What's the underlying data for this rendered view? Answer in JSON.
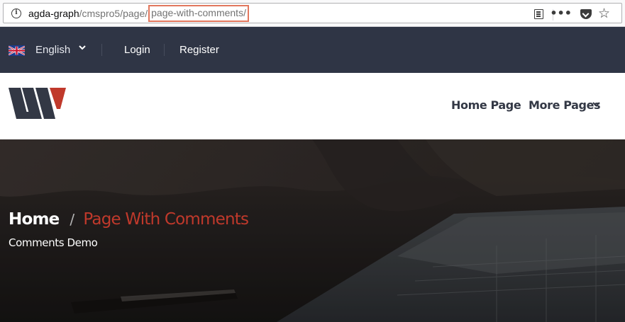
{
  "browser": {
    "url_host": "agda-graph",
    "url_path": "/cmspro5/page/",
    "url_highlight": "page-with-comments/",
    "highlight_color": "#e2775d"
  },
  "topbar": {
    "language": "English",
    "flag_icon": "uk-flag-icon",
    "login_label": "Login",
    "register_label": "Register",
    "background": "#2f3545"
  },
  "header": {
    "logo_icon": "w-logo-icon",
    "nav": {
      "home_label": "Home Page",
      "more_label": "More Pages"
    },
    "accent": "#c0392b"
  },
  "hero": {
    "breadcrumb_home": "Home",
    "breadcrumb_separator": "/",
    "breadcrumb_current": "Page With Comments",
    "subtitle": "Comments Demo"
  }
}
